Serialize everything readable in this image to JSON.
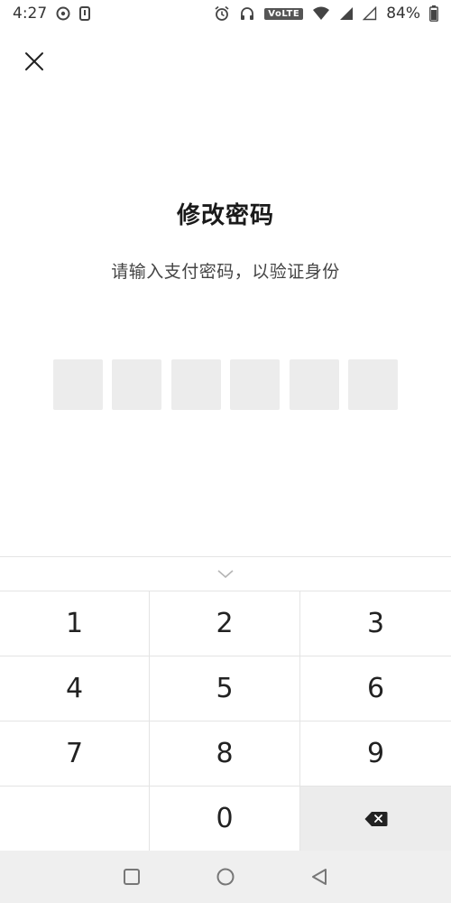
{
  "status_bar": {
    "time": "4:27",
    "volte": "VoLTE",
    "battery": "84%"
  },
  "title": "修改密码",
  "subtitle": "请输入支付密码，以验证身份",
  "pin": {
    "length": 6
  },
  "keypad": {
    "keys": [
      "1",
      "2",
      "3",
      "4",
      "5",
      "6",
      "7",
      "8",
      "9",
      "",
      "0",
      ""
    ]
  },
  "icons": {
    "close": "close-icon",
    "collapse": "chevron-down-icon",
    "backspace": "backspace-icon",
    "nav_recent": "square-icon",
    "nav_home": "circle-icon",
    "nav_back": "triangle-back-icon"
  }
}
